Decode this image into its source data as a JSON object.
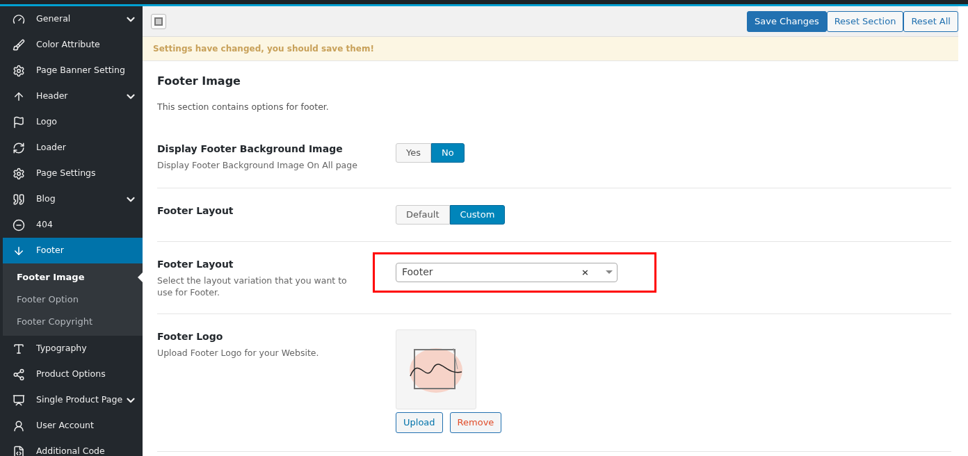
{
  "sidebar": {
    "items": [
      {
        "label": "General",
        "has_submenu": true,
        "selected": false
      },
      {
        "label": "Color Attribute",
        "has_submenu": false,
        "selected": false
      },
      {
        "label": "Page Banner Setting",
        "has_submenu": false,
        "selected": false
      },
      {
        "label": "Header",
        "has_submenu": true,
        "selected": false
      },
      {
        "label": "Logo",
        "has_submenu": false,
        "selected": false
      },
      {
        "label": "Loader",
        "has_submenu": false,
        "selected": false
      },
      {
        "label": "Page Settings",
        "has_submenu": false,
        "selected": false
      },
      {
        "label": "Blog",
        "has_submenu": true,
        "selected": false
      },
      {
        "label": "404",
        "has_submenu": false,
        "selected": false
      },
      {
        "label": "Footer",
        "has_submenu": false,
        "selected": true,
        "children": [
          {
            "label": "Footer Image",
            "selected": true
          },
          {
            "label": "Footer Option",
            "selected": false
          },
          {
            "label": "Footer Copyright",
            "selected": false
          }
        ]
      },
      {
        "label": "Typography",
        "has_submenu": false,
        "selected": false
      },
      {
        "label": "Product Options",
        "has_submenu": false,
        "selected": false
      },
      {
        "label": "Single Product Page",
        "has_submenu": true,
        "selected": false
      },
      {
        "label": "User Account",
        "has_submenu": false,
        "selected": false
      },
      {
        "label": "Additional Code",
        "has_submenu": false,
        "selected": false
      }
    ]
  },
  "toolbar": {
    "buttons": [
      {
        "label": "Save Changes",
        "kind": "primary"
      },
      {
        "label": "Reset Section",
        "kind": "secondary"
      },
      {
        "label": "Reset All",
        "kind": "secondary"
      }
    ]
  },
  "notice": "Settings have changed, you should save them!",
  "section": {
    "title": "Footer Image",
    "description": "This section contains options for footer."
  },
  "fields": [
    {
      "kind": "toggle",
      "label": "Display Footer Background Image",
      "description": "Display Footer Background Image On All page",
      "options": [
        {
          "label": "Yes",
          "selected": false
        },
        {
          "label": "No",
          "selected": true
        }
      ]
    },
    {
      "kind": "toggle",
      "label": "Footer Layout",
      "options": [
        {
          "label": "Default",
          "selected": false
        },
        {
          "label": "Custom",
          "selected": true
        }
      ]
    },
    {
      "kind": "select",
      "label": "Footer Layout",
      "description": "Select the layout variation that you want to use for Footer.",
      "value": "Footer",
      "clear": "×",
      "highlighted": true
    },
    {
      "kind": "media",
      "label": "Footer Logo",
      "description": "Upload Footer Logo for your Website.",
      "upload": "Upload",
      "remove": "Remove"
    }
  ]
}
